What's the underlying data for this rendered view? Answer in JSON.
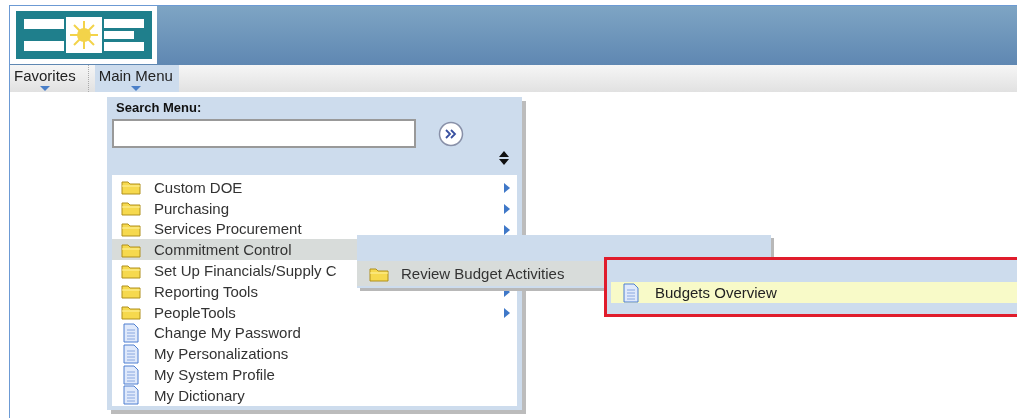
{
  "nav": [
    {
      "label": "Favorites",
      "selected": false
    },
    {
      "label": "Main Menu",
      "selected": true
    }
  ],
  "main_menu": {
    "search_label": "Search Menu:",
    "items": [
      {
        "label": "Custom DOE",
        "kind": "folder",
        "arrow": true,
        "selected": false
      },
      {
        "label": "Purchasing",
        "kind": "folder",
        "arrow": true,
        "selected": false
      },
      {
        "label": "Services Procurement",
        "kind": "folder",
        "arrow": true,
        "selected": false
      },
      {
        "label": "Commitment Control",
        "kind": "folder",
        "arrow": false,
        "selected": true
      },
      {
        "label": "Set Up Financials/Supply C",
        "kind": "folder",
        "arrow": false,
        "selected": false
      },
      {
        "label": "Reporting Tools",
        "kind": "folder",
        "arrow": true,
        "selected": false
      },
      {
        "label": "PeopleTools",
        "kind": "folder",
        "arrow": true,
        "selected": false
      },
      {
        "label": "Change My Password",
        "kind": "page",
        "arrow": false,
        "selected": false
      },
      {
        "label": "My Personalizations",
        "kind": "page",
        "arrow": false,
        "selected": false
      },
      {
        "label": "My System Profile",
        "kind": "page",
        "arrow": false,
        "selected": false
      },
      {
        "label": "My Dictionary",
        "kind": "page",
        "arrow": false,
        "selected": false
      }
    ]
  },
  "submenu": {
    "items": [
      {
        "label": "Review Budget Activities",
        "kind": "folder",
        "selected": true
      }
    ]
  },
  "submenu_2": {
    "annotated": true,
    "items": [
      {
        "label": "Budgets Overview",
        "kind": "page",
        "selected": true
      }
    ]
  }
}
